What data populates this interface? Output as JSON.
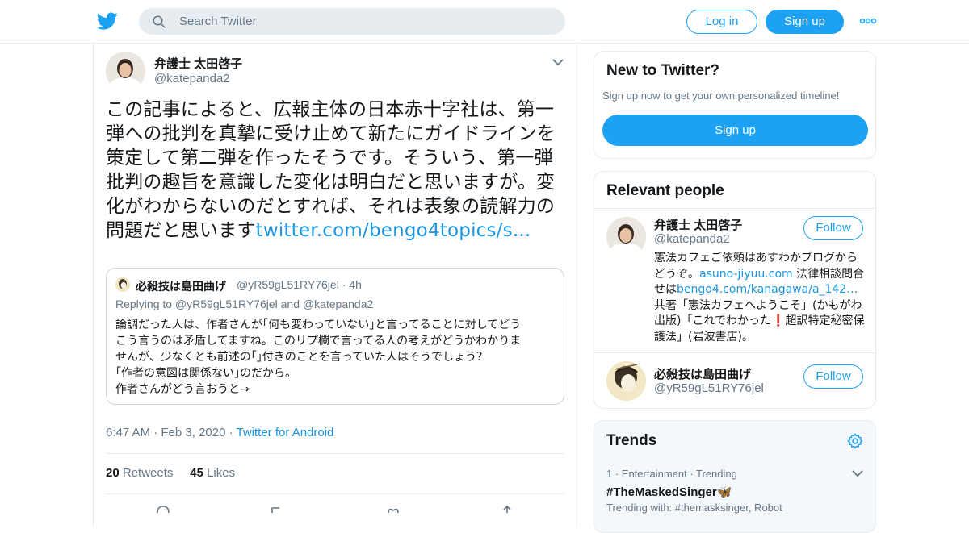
{
  "header": {
    "search_placeholder": "Search Twitter",
    "login_label": "Log in",
    "signup_label": "Sign up"
  },
  "tweet": {
    "author_name": "弁護士 太田啓子",
    "author_handle": "@katepanda2",
    "text": "この記事によると、広報主体の日本赤十字社は、第一弾への批判を真摯に受け止めて新たにガイドラインを策定して第二弾を作ったそうです。そういう、第一弾批判の趣旨を意識した変化は明白だと思いますが。変化がわからないのだとすれば、それは表象の読解力の問題だと思います",
    "link": "twitter.com/bengo4topics/s...",
    "quote": {
      "author_name": "必殺技は島田曲げ",
      "author_handle": "@yR59gL51RY76jel",
      "time": "4h",
      "replying_to": "Replying to @yR59gL51RY76jel and @katepanda2",
      "lines": [
        "論調だった人は、作者さんが｢何も変わっていない｣と言ってることに対してどう",
        "こう言うのは矛盾してますね。このリプ欄で言ってる人の考えがどうかわかりま",
        "せんが、少なくとも前述の｢｣付きのことを言っていた人はそうでしょう？",
        "｢作者の意図は関係ない｣のだから。",
        "作者さんがどう言おうと→"
      ]
    },
    "time": "6:47 AM",
    "date": "Feb 3, 2020",
    "source": "Twitter for Android",
    "retweets_count": "20",
    "retweets_label": "Retweets",
    "likes_count": "45",
    "likes_label": "Likes"
  },
  "sidebar": {
    "new_to_twitter": {
      "title": "New to Twitter?",
      "subtitle": "Sign up now to get your own personalized timeline!",
      "button": "Sign up"
    },
    "relevant_people": {
      "title": "Relevant people",
      "people": [
        {
          "name": "弁護士 太田啓子",
          "handle": "@katepanda2",
          "follow_label": "Follow",
          "bio": {
            "part1": "憲法カフェご依頼はあすわかブログからどうぞ。",
            "link1": "asuno-jiyuu.com",
            "part2": " 法律相談問合せは",
            "link2": "bengo4.com/kanagawa/a_142…",
            "part3": " 共著「憲法カフェへようこそ」(かもがわ出版)「これでわかった",
            "mark": "❗",
            "part4": "超訳特定秘密保護法」(岩波書店)。"
          }
        },
        {
          "name": "必殺技は島田曲げ",
          "handle": "@yR59gL51RY76jel",
          "follow_label": "Follow"
        }
      ]
    },
    "trends": {
      "title": "Trends",
      "items": [
        {
          "meta": "1 · Entertainment · Trending",
          "name": "#TheMaskedSinger🦋",
          "with": "Trending with: #themasksinger, Robot"
        }
      ]
    }
  },
  "colors": {
    "brand": "#1da1f2",
    "link": "#1b95e0",
    "secondary_text": "#657786",
    "border": "#e6ecf0"
  },
  "icons": [
    "twitter-bird-icon",
    "search-icon",
    "more-dots-icon",
    "chevron-down-icon",
    "gear-icon"
  ]
}
